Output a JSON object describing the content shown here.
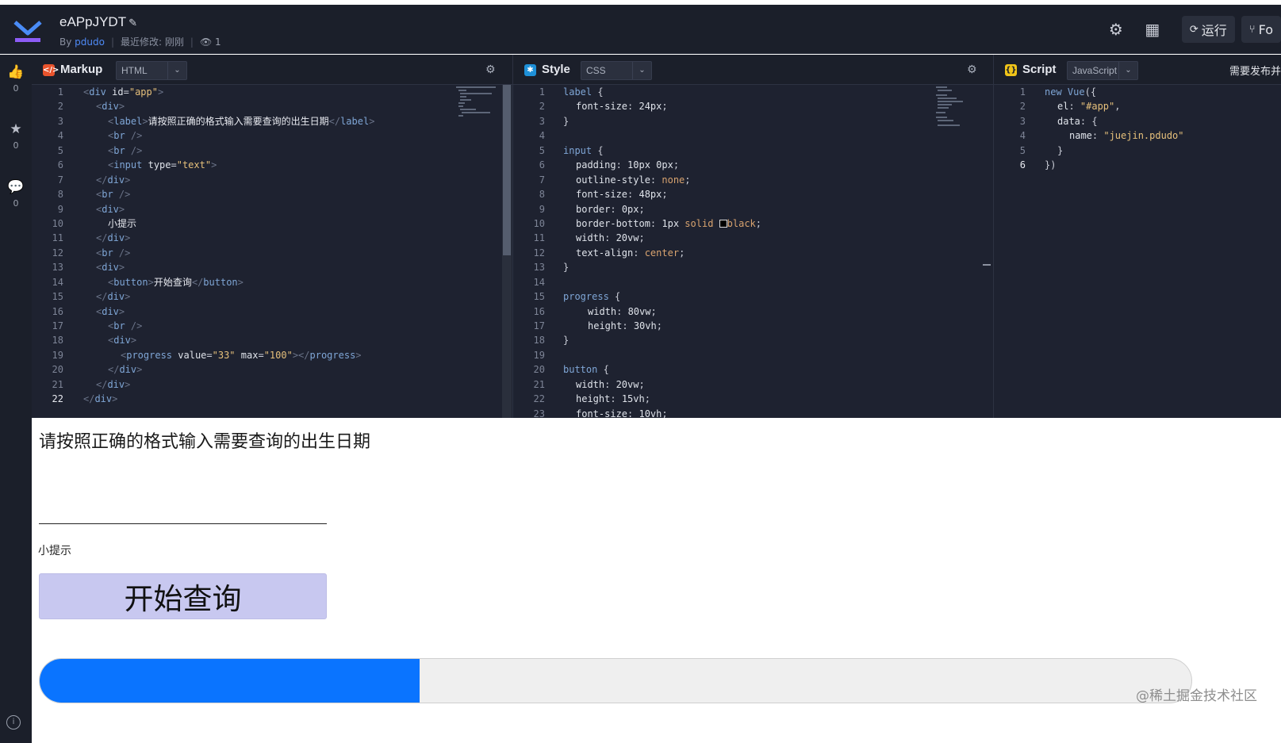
{
  "header": {
    "title": "eAPpJYDT",
    "by_prefix": "By",
    "author": "pdudo",
    "modified_label": "最近修改: 刚刚",
    "views": "1",
    "run_label": "运行",
    "fork_label": "Fo",
    "icons": [
      "gear-icon",
      "layout-icon",
      "run-icon",
      "fork-icon"
    ]
  },
  "rail": {
    "likes": "0",
    "stars": "0",
    "comments": "0"
  },
  "markup": {
    "title": "Markup",
    "lang": "HTML",
    "accent": "#e9542d",
    "active_line": 22
  },
  "style": {
    "title": "Style",
    "lang": "CSS",
    "accent": "#1e90d8"
  },
  "script": {
    "title": "Script",
    "lang": "JavaScript",
    "note": "需要发布并",
    "accent": "#f0c419"
  },
  "preview": {
    "label": "请按照正确的格式输入需要查询的出生日期",
    "tip": "小提示",
    "button": "开始查询",
    "progress_value": 33,
    "progress_max": 100,
    "watermark": "@稀土掘金技术社区"
  }
}
